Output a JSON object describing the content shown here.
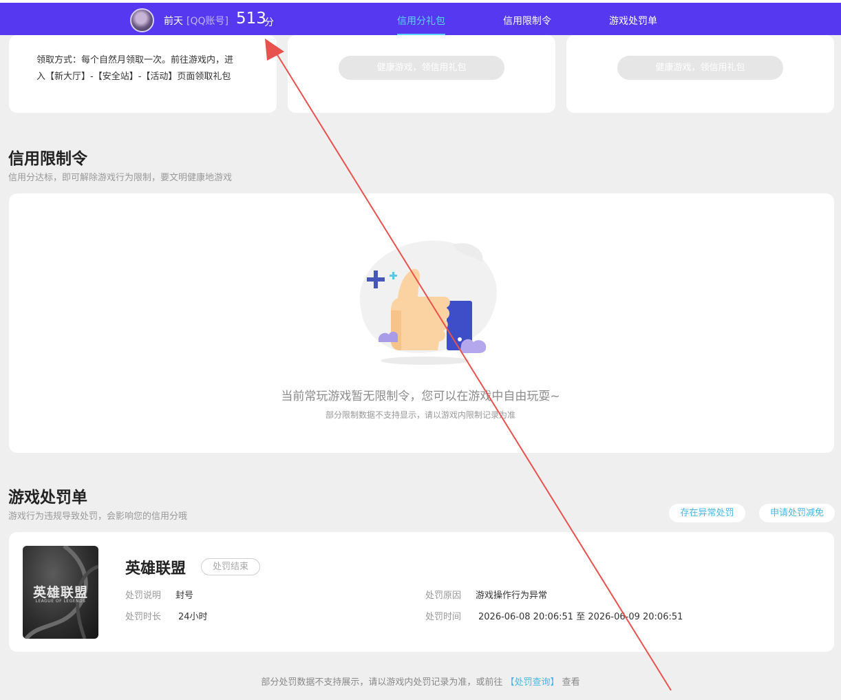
{
  "header": {
    "username": "前天",
    "account_type": "[QQ账号]",
    "score": "513",
    "score_unit": "分",
    "tabs": [
      {
        "label": "信用分礼包",
        "active": true
      },
      {
        "label": "信用限制令",
        "active": false
      },
      {
        "label": "游戏处罚单",
        "active": false
      }
    ],
    "accent_color": "#5538f0",
    "active_tab_color": "#5cd3ff"
  },
  "gift_cards": {
    "claim_text_line1": "领取方式：每个自然月领取一次。前往游戏内，进",
    "claim_text_line2": "入【新大厅】-【安全站】-【活动】页面领取礼包",
    "button_label": "健康游戏，领信用礼包"
  },
  "restriction": {
    "title": "信用限制令",
    "subtitle": "信用分达标，即可解除游戏行为限制，要文明健康地游戏",
    "empty_message": "当前常玩游戏暂无限制令，您可以在游戏中自由玩耍~",
    "empty_note": "部分限制数据不支持显示，请以游戏内限制记录为准",
    "illustration_icon": "thumbs-up-icon"
  },
  "punishment": {
    "title": "游戏处罚单",
    "subtitle": "游戏行为违规导致处罚，会影响您的信用分哦",
    "actions": [
      "存在异常处罚",
      "申请处罚减免"
    ],
    "item": {
      "logo_text": "英雄联盟",
      "logo_subtext": "LEAGUE OF LEGENDS",
      "game": "英雄联盟",
      "status": "处罚结束",
      "desc_label": "处罚说明",
      "desc_value": "封号",
      "reason_label": "处罚原因",
      "reason_value": "游戏操作行为异常",
      "duration_label": "处罚时长",
      "duration_value": "24小时",
      "time_label": "处罚时间",
      "time_value": "2026-06-08 20:06:51 至 2026-06-09 20:06:51"
    }
  },
  "footer": {
    "text_before": "部分处罚数据不支持展示，请以游戏内处罚记录为准，或前往",
    "link": "【处罚查询】",
    "text_after": "查看"
  },
  "annotation": {
    "color": "#e8524d",
    "icon": "red-arrow-annotation"
  }
}
